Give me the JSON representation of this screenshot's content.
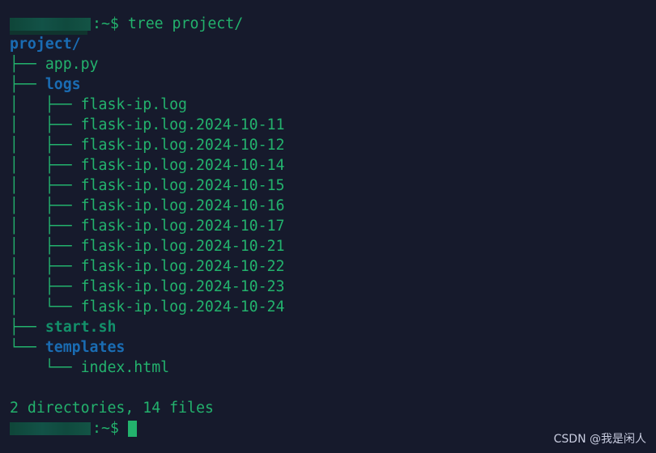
{
  "prompt": {
    "user_host": "[redacted]",
    "suffix": ":~$ ",
    "command": "tree project/"
  },
  "tree": {
    "root": "project/",
    "entries": [
      {
        "prefix": "├── ",
        "name": "app.py",
        "type": "file"
      },
      {
        "prefix": "├── ",
        "name": "logs",
        "type": "dir"
      },
      {
        "prefix": "│   ├── ",
        "name": "flask-ip.log",
        "type": "file"
      },
      {
        "prefix": "│   ├── ",
        "name": "flask-ip.log.2024-10-11",
        "type": "file"
      },
      {
        "prefix": "│   ├── ",
        "name": "flask-ip.log.2024-10-12",
        "type": "file"
      },
      {
        "prefix": "│   ├── ",
        "name": "flask-ip.log.2024-10-14",
        "type": "file"
      },
      {
        "prefix": "│   ├── ",
        "name": "flask-ip.log.2024-10-15",
        "type": "file"
      },
      {
        "prefix": "│   ├── ",
        "name": "flask-ip.log.2024-10-16",
        "type": "file"
      },
      {
        "prefix": "│   ├── ",
        "name": "flask-ip.log.2024-10-17",
        "type": "file"
      },
      {
        "prefix": "│   ├── ",
        "name": "flask-ip.log.2024-10-21",
        "type": "file"
      },
      {
        "prefix": "│   ├── ",
        "name": "flask-ip.log.2024-10-22",
        "type": "file"
      },
      {
        "prefix": "│   ├── ",
        "name": "flask-ip.log.2024-10-23",
        "type": "file"
      },
      {
        "prefix": "│   └── ",
        "name": "flask-ip.log.2024-10-24",
        "type": "file"
      },
      {
        "prefix": "├── ",
        "name": "start.sh",
        "type": "exec"
      },
      {
        "prefix": "└── ",
        "name": "templates",
        "type": "dir"
      },
      {
        "prefix": "    └── ",
        "name": "index.html",
        "type": "file"
      }
    ],
    "summary": "2 directories, 14 files"
  },
  "colors": {
    "background": "#161a2c",
    "text_green": "#23b26d",
    "directory_blue": "#1a6cb3",
    "executable_green": "#13906a"
  },
  "watermark": "CSDN @我是闲人"
}
